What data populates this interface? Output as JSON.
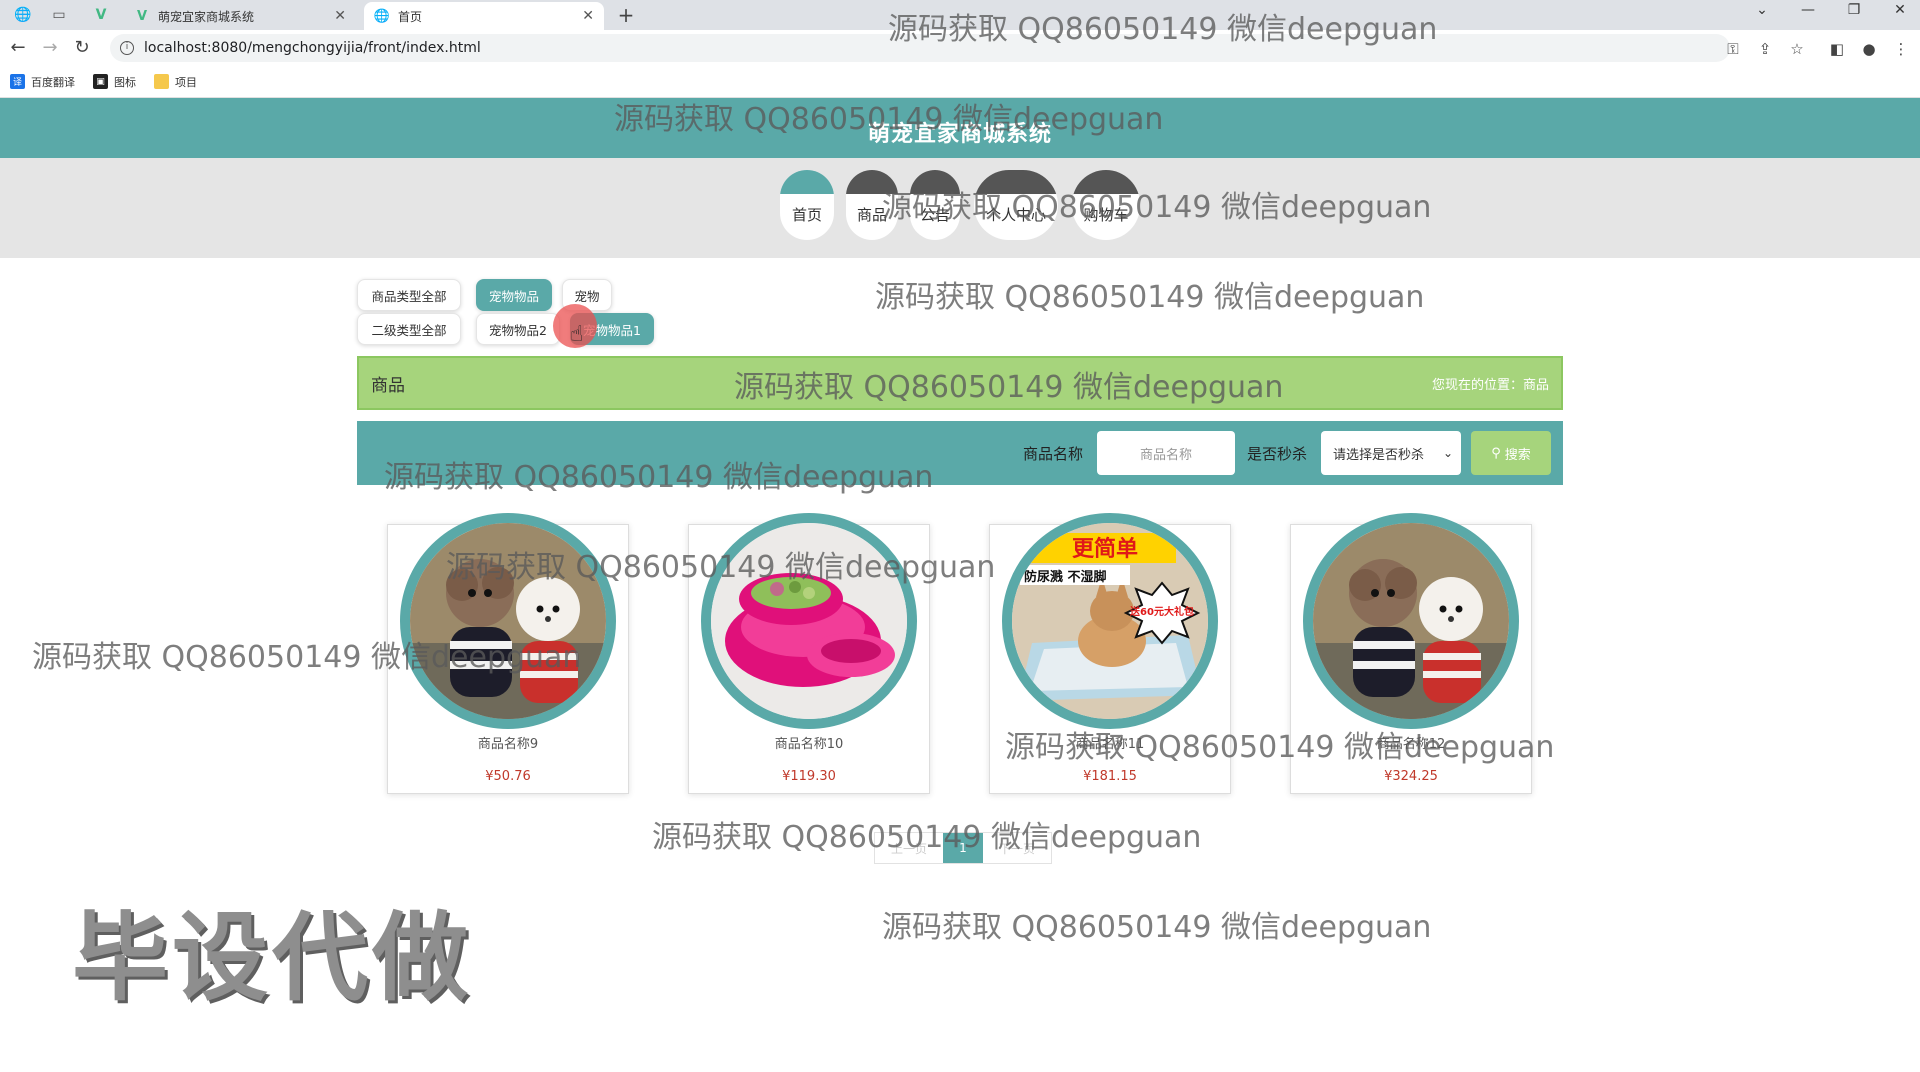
{
  "browser": {
    "tabs": [
      {
        "title": "萌宠宜家商城系统",
        "active": false
      },
      {
        "title": "首页",
        "active": true
      }
    ],
    "new_tab_symbol": "+",
    "url": "localhost:8080/mengchongyijia/front/index.html",
    "bookmarks": [
      {
        "label": "百度翻译",
        "icon": "translate-icon",
        "color": "#1a73e8"
      },
      {
        "label": "图标",
        "icon": "image-icon",
        "color": "#222222"
      },
      {
        "label": "项目",
        "icon": "folder-icon",
        "color": "#f5c84c"
      }
    ]
  },
  "site": {
    "title": "萌宠宜家商城系统",
    "accent_color": "#5aa9a8",
    "green_color": "#a6d47c"
  },
  "nav": {
    "items": [
      {
        "label": "首页"
      },
      {
        "label": "商品"
      },
      {
        "label": "公告"
      },
      {
        "label": "个人中心"
      },
      {
        "label": "购物车"
      }
    ]
  },
  "filters": {
    "type_all": "商品类型全部",
    "types": [
      "宠物物品",
      "宠物"
    ],
    "subtype_all": "二级类型全部",
    "subtypes": [
      "宠物物品2",
      "宠物物品1"
    ]
  },
  "crumb": {
    "title": "商品",
    "location": "您现在的位置：商品"
  },
  "search": {
    "name_label": "商品名称",
    "name_placeholder": "商品名称",
    "seckill_label": "是否秒杀",
    "seckill_selected": "请选择是否秒杀",
    "button_label": "搜索"
  },
  "products": [
    {
      "name": "商品名称9",
      "price": "¥50.76",
      "image": "dogs-photo"
    },
    {
      "name": "商品名称10",
      "price": "¥119.30",
      "image": "pink-bowl-photo"
    },
    {
      "name": "商品名称11",
      "price": "¥181.15",
      "image": "pee-tray-photo"
    },
    {
      "name": "商品名称12",
      "price": "¥324.25",
      "image": "dogs-photo"
    }
  ],
  "pager": {
    "prev": "上一页",
    "current": "1",
    "next": "下一页"
  },
  "watermarks": {
    "text": "源码获取 QQ86050149 微信deepguan",
    "big_text": "毕设代做"
  },
  "promo_text": {
    "line1": "更简单",
    "line2": "防尿溅 不湿脚",
    "badge": "送60元大礼包"
  }
}
